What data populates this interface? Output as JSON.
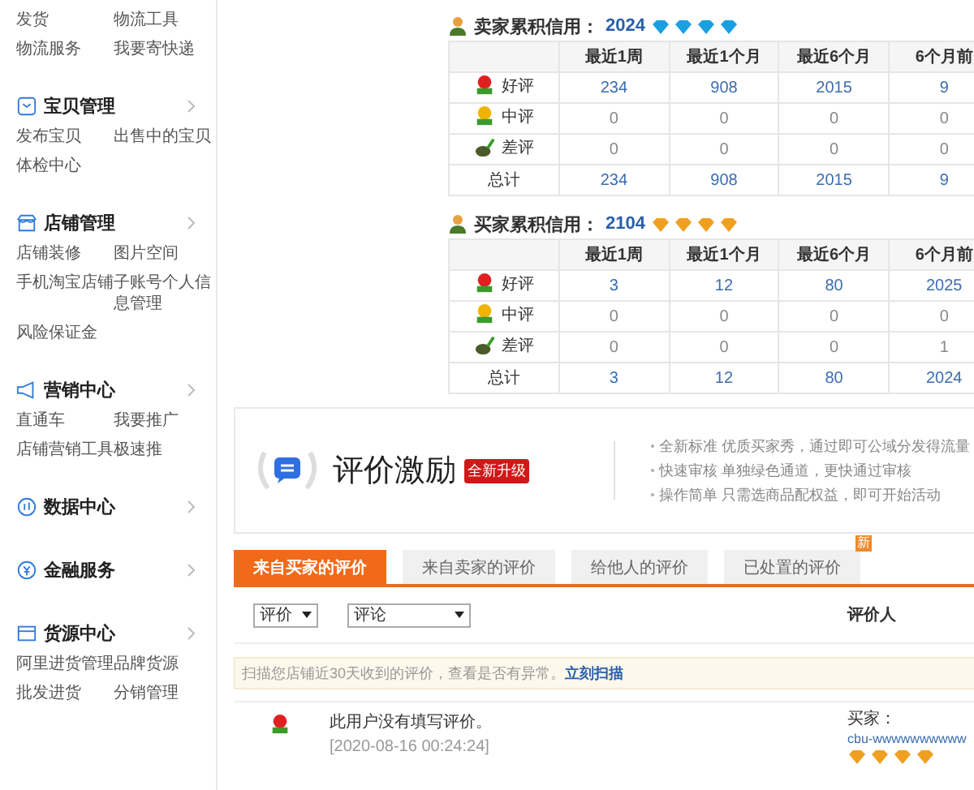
{
  "sidebar": {
    "sections": [
      {
        "links": [
          "发货",
          "物流工具",
          "物流服务",
          "我要寄快递"
        ]
      },
      {
        "title": "宝贝管理",
        "expandable": true,
        "links": [
          "发布宝贝",
          "出售中的宝贝",
          "体检中心"
        ]
      },
      {
        "title": "店铺管理",
        "expandable": true,
        "links": [
          "店铺装修",
          "图片空间",
          "手机淘宝店铺",
          "子账号个人信息管理",
          "风险保证金"
        ]
      },
      {
        "title": "营销中心",
        "expandable": true,
        "links": [
          "直通车",
          "我要推广",
          "店铺营销工具",
          "极速推"
        ]
      },
      {
        "title": "数据中心",
        "expandable": true
      },
      {
        "title": "金融服务",
        "expandable": true
      },
      {
        "title": "货源中心",
        "expandable": true,
        "links": [
          "阿里进货管理",
          "品牌货源",
          "批发进货",
          "分销管理"
        ]
      }
    ]
  },
  "credit_tables": [
    {
      "label": "卖家累积信用：",
      "score": "2024",
      "color": "#1aa0e0",
      "stars": 4,
      "columns": [
        "最近1周",
        "最近1个月",
        "最近6个月",
        "6个月前"
      ],
      "rows": [
        {
          "kind": "good",
          "label": "好评",
          "values": [
            "234",
            "908",
            "2015",
            "9"
          ]
        },
        {
          "kind": "neutral",
          "label": "中评",
          "values": [
            "0",
            "0",
            "0",
            "0"
          ]
        },
        {
          "kind": "bad",
          "label": "差评",
          "values": [
            "0",
            "0",
            "0",
            "0"
          ]
        },
        {
          "kind": "total",
          "label": "总计",
          "values": [
            "234",
            "908",
            "2015",
            "9"
          ]
        }
      ]
    },
    {
      "label": "买家累积信用：",
      "score": "2104",
      "color": "#f0a020",
      "stars": 4,
      "columns": [
        "最近1周",
        "最近1个月",
        "最近6个月",
        "6个月前"
      ],
      "rows": [
        {
          "kind": "good",
          "label": "好评",
          "values": [
            "3",
            "12",
            "80",
            "2025"
          ]
        },
        {
          "kind": "neutral",
          "label": "中评",
          "values": [
            "0",
            "0",
            "0",
            "0"
          ]
        },
        {
          "kind": "bad",
          "label": "差评",
          "values": [
            "0",
            "0",
            "0",
            "1"
          ]
        },
        {
          "kind": "total",
          "label": "总计",
          "values": [
            "3",
            "12",
            "80",
            "2024"
          ]
        }
      ]
    }
  ],
  "banner": {
    "title": "评价激励",
    "tag": "全新升级",
    "points": [
      "全新标准 优质买家秀，通过即可公域分发得流量",
      "快速审核 单独绿色通道，更快通过审核",
      "操作简单 只需选商品配权益，即可开始活动"
    ]
  },
  "tabs": [
    {
      "label": "来自买家的评价",
      "selected": true
    },
    {
      "label": "来自卖家的评价",
      "selected": false
    },
    {
      "label": "给他人的评价",
      "selected": false
    },
    {
      "label": "已处置的评价",
      "selected": false,
      "badge": "新"
    }
  ],
  "filters": [
    {
      "value": "评价"
    },
    {
      "value": "评论"
    }
  ],
  "column_header": "评价人",
  "notice": {
    "text": "扫描您店铺近30天收到的评价，查看是否有异常。",
    "link": "立刻扫描"
  },
  "reviews": [
    {
      "kind": "good",
      "text": "此用户没有填写评价。",
      "date": "[2020-08-16 00:24:24]",
      "reviewer_label": "买家：",
      "reviewer": "cbu-wwwwwwwwww",
      "stars": 4
    }
  ]
}
